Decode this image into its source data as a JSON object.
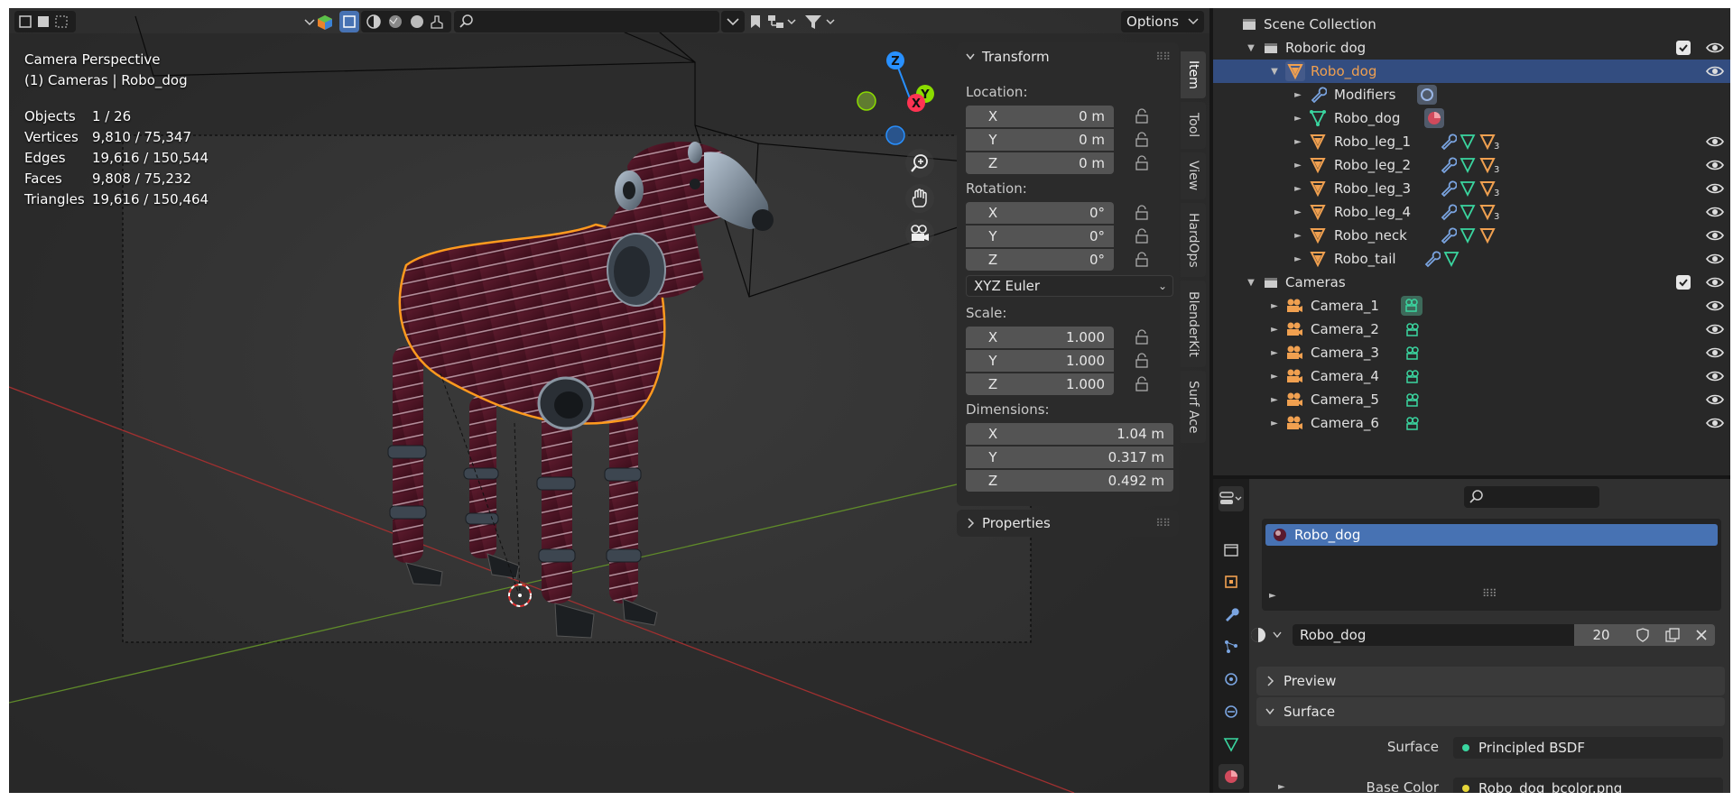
{
  "colors": {
    "accent": "#4772b3",
    "selected_row": "#334d80",
    "object_orange": "#f0a050",
    "modifier_blue": "#7aa4e0",
    "mesh_green": "#3ad6a0",
    "axis_x": "#ff3352",
    "axis_y": "#8bdc00",
    "axis_z": "#2890ff"
  },
  "viewport": {
    "options_label": "Options",
    "view_name": "Camera Perspective",
    "collection_info": "(1) Cameras | Robo_dog",
    "stats": [
      {
        "label": "Objects",
        "value": "1 / 26"
      },
      {
        "label": "Vertices",
        "value": "9,810 / 75,347"
      },
      {
        "label": "Edges",
        "value": "19,616 / 150,544"
      },
      {
        "label": "Faces",
        "value": "9,808 / 75,232"
      },
      {
        "label": "Triangles",
        "value": "19,616 / 150,464"
      }
    ],
    "gizmo": {
      "x": "X",
      "y": "Y",
      "z": "Z"
    },
    "nav_icons": [
      "zoom-icon",
      "hand-icon",
      "camera-icon"
    ]
  },
  "npanel": {
    "transform_title": "Transform",
    "location_label": "Location:",
    "location": [
      {
        "axis": "X",
        "value": "0 m"
      },
      {
        "axis": "Y",
        "value": "0 m"
      },
      {
        "axis": "Z",
        "value": "0 m"
      }
    ],
    "rotation_label": "Rotation:",
    "rotation": [
      {
        "axis": "X",
        "value": "0°"
      },
      {
        "axis": "Y",
        "value": "0°"
      },
      {
        "axis": "Z",
        "value": "0°"
      }
    ],
    "rotation_mode": "XYZ Euler",
    "scale_label": "Scale:",
    "scale": [
      {
        "axis": "X",
        "value": "1.000"
      },
      {
        "axis": "Y",
        "value": "1.000"
      },
      {
        "axis": "Z",
        "value": "1.000"
      }
    ],
    "dimensions_label": "Dimensions:",
    "dimensions": [
      {
        "axis": "X",
        "value": "1.04 m"
      },
      {
        "axis": "Y",
        "value": "0.317 m"
      },
      {
        "axis": "Z",
        "value": "0.492 m"
      }
    ],
    "properties_title": "Properties"
  },
  "vtabs": [
    "Item",
    "Tool",
    "View",
    "HardOps",
    "BlenderKit",
    "Surf Ace"
  ],
  "outliner": {
    "scene_collection": "Scene Collection",
    "rows": [
      {
        "label": "Roboric dog",
        "kind": "collection"
      },
      {
        "label": "Robo_dog",
        "kind": "object"
      },
      {
        "label": "Modifiers",
        "kind": "modifiers"
      },
      {
        "label": "Robo_dog",
        "kind": "mesh"
      },
      {
        "label": "Robo_leg_1",
        "kind": "object",
        "badge": "3"
      },
      {
        "label": "Robo_leg_2",
        "kind": "object",
        "badge": "3"
      },
      {
        "label": "Robo_leg_3",
        "kind": "object",
        "badge": "3"
      },
      {
        "label": "Robo_leg_4",
        "kind": "object",
        "badge": "3"
      },
      {
        "label": "Robo_neck",
        "kind": "object"
      },
      {
        "label": "Robo_tail",
        "kind": "object"
      },
      {
        "label": "Cameras",
        "kind": "collection"
      },
      {
        "label": "Camera_1",
        "kind": "camera"
      },
      {
        "label": "Camera_2",
        "kind": "camera"
      },
      {
        "label": "Camera_3",
        "kind": "camera"
      },
      {
        "label": "Camera_4",
        "kind": "camera"
      },
      {
        "label": "Camera_5",
        "kind": "camera"
      },
      {
        "label": "Camera_6",
        "kind": "camera"
      }
    ]
  },
  "properties": {
    "material_slot": "Robo_dog",
    "material_name": "Robo_dog",
    "users": "20",
    "preview_label": "Preview",
    "surface_panel": "Surface",
    "surface_label": "Surface",
    "surface_value": "Principled BSDF",
    "base_color_label": "Base Color",
    "base_color_value": "Robo_dog_bcolor.png"
  }
}
